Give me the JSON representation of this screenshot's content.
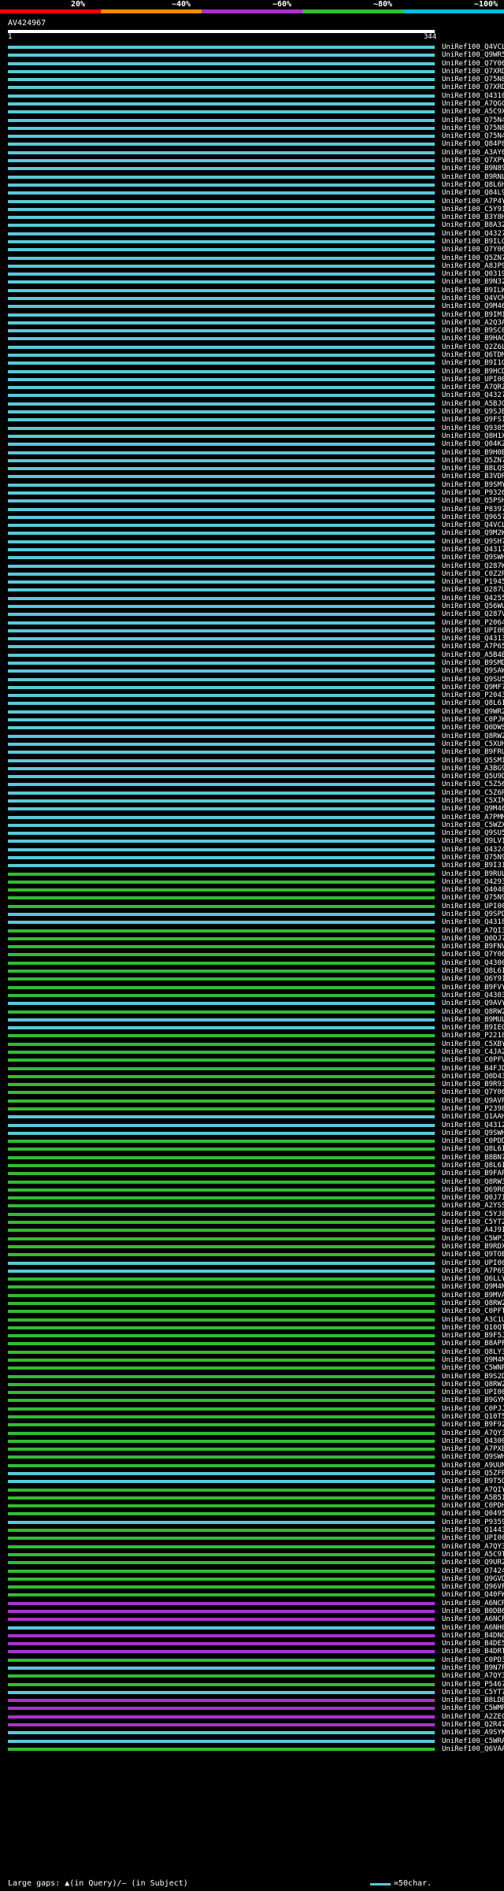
{
  "legend": {
    "labels": [
      "20%",
      "~40%",
      "~60%",
      "~80%",
      "~100%"
    ],
    "colors": [
      "#ff0000",
      "#ff8800",
      "#aa33cc",
      "#33bb33",
      "#00bfd7"
    ]
  },
  "query": {
    "name": "AV424967",
    "start": "1",
    "end": "344"
  },
  "hits": [
    {
      "label": "UniRef100_Q4VCL9",
      "color": "#59c9d9"
    },
    {
      "label": "UniRef100_Q9WR52",
      "color": "#59c9d9"
    },
    {
      "label": "UniRef100_Q7Y068",
      "color": "#59c9d9"
    },
    {
      "label": "UniRef100_Q7XRD3",
      "color": "#59c9d9"
    },
    {
      "label": "UniRef100_Q75N87",
      "color": "#59c9d9"
    },
    {
      "label": "UniRef100_Q7XRD1",
      "color": "#59c9d9"
    },
    {
      "label": "UniRef100_Q43106",
      "color": "#59c9d9"
    },
    {
      "label": "UniRef100_A7QGC0",
      "color": "#59c9d9"
    },
    {
      "label": "UniRef100_A5C9X8",
      "color": "#59c9d9"
    },
    {
      "label": "UniRef100_Q75N40",
      "color": "#59c9d9"
    },
    {
      "label": "UniRef100_Q75N88",
      "color": "#59c9d9"
    },
    {
      "label": "UniRef100_Q75N41",
      "color": "#59c9d9"
    },
    {
      "label": "UniRef100_Q84P88",
      "color": "#59c9d9"
    },
    {
      "label": "UniRef100_A3AY68",
      "color": "#59c9d9"
    },
    {
      "label": "UniRef100_Q7XPY2",
      "color": "#59c9d9"
    },
    {
      "label": "UniRef100_B9N895",
      "color": "#59c9d9"
    },
    {
      "label": "UniRef100_B9RNL5",
      "color": "#59c9d9"
    },
    {
      "label": "UniRef100_Q8L6H2",
      "color": "#59c9d9"
    },
    {
      "label": "UniRef100_Q84L97",
      "color": "#59c9d9"
    },
    {
      "label": "UniRef100_A7P4Y4",
      "color": "#59c9d9"
    },
    {
      "label": "UniRef100_C5Y910",
      "color": "#59c9d9"
    },
    {
      "label": "UniRef100_B3Y8H6",
      "color": "#59c9d9"
    },
    {
      "label": "UniRef100_B8A326",
      "color": "#59c9d9"
    },
    {
      "label": "UniRef100_Q43275",
      "color": "#59c9d9"
    },
    {
      "label": "UniRef100_B9ILG8",
      "color": "#59c9d9"
    },
    {
      "label": "UniRef100_Q7Y067",
      "color": "#59c9d9"
    },
    {
      "label": "UniRef100_Q5ZN71",
      "color": "#59c9d9"
    },
    {
      "label": "UniRef100_A8JP99",
      "color": "#59c9d9"
    },
    {
      "label": "UniRef100_Q03194",
      "color": "#59c9d9"
    },
    {
      "label": "UniRef100_B9N321",
      "color": "#59c9d9"
    },
    {
      "label": "UniRef100_B9ILW8",
      "color": "#59c9d9"
    },
    {
      "label": "UniRef100_Q4VCM0",
      "color": "#59c9d9"
    },
    {
      "label": "UniRef100_Q9M461",
      "color": "#59c9d9"
    },
    {
      "label": "UniRef100_B9IM11",
      "color": "#59c9d9"
    },
    {
      "label": "UniRef100_A2Q3A6",
      "color": "#59c9d9"
    },
    {
      "label": "UniRef100_B9SC05",
      "color": "#59c9d9"
    },
    {
      "label": "UniRef100_B9HAQ1",
      "color": "#59c9d9"
    },
    {
      "label": "UniRef100_Q2Z6L3",
      "color": "#59c9d9"
    },
    {
      "label": "UniRef100_Q6TDM4",
      "color": "#59c9d9"
    },
    {
      "label": "UniRef100_B9I1G7",
      "color": "#59c9d9"
    },
    {
      "label": "UniRef100_B9HCD3",
      "color": "#59c9d9"
    },
    {
      "label": "UniRef100_UPI000..",
      "color": "#59c9d9"
    },
    {
      "label": "UniRef100_A7QRZ8",
      "color": "#59c9d9"
    },
    {
      "label": "UniRef100_Q43271",
      "color": "#59c9d9"
    },
    {
      "label": "UniRef100_A5BJG2",
      "color": "#59c9d9"
    },
    {
      "label": "UniRef100_Q9SJB3",
      "color": "#59c9d9"
    },
    {
      "label": "UniRef100_Q9FS17",
      "color": "#59c9d9"
    },
    {
      "label": "UniRef100_Q93052",
      "color": "#59c9d9"
    },
    {
      "label": "UniRef100_Q8H1X2",
      "color": "#59c9d9"
    },
    {
      "label": "UniRef100_Q04KZ5",
      "color": "#59c9d9"
    },
    {
      "label": "UniRef100_B9H0B5",
      "color": "#59c9d9"
    },
    {
      "label": "UniRef100_Q5ZN70",
      "color": "#59c9d9"
    },
    {
      "label": "UniRef100_B8LQS1",
      "color": "#59c9d9"
    },
    {
      "label": "UniRef100_B3VDR8",
      "color": "#59c9d9"
    },
    {
      "label": "UniRef100_B9SMY3",
      "color": "#59c9d9"
    },
    {
      "label": "UniRef100_P93265",
      "color": "#59c9d9"
    },
    {
      "label": "UniRef100_Q5PSH6",
      "color": "#59c9d9"
    },
    {
      "label": "UniRef100_P83970",
      "color": "#59c9d9"
    },
    {
      "label": "UniRef100_Q96578",
      "color": "#59c9d9"
    },
    {
      "label": "UniRef100_Q4VCL8",
      "color": "#59c9d9"
    },
    {
      "label": "UniRef100_Q9M2W0",
      "color": "#59c9d9"
    },
    {
      "label": "UniRef100_Q9SH76",
      "color": "#59c9d9"
    },
    {
      "label": "UniRef100_Q43178",
      "color": "#59c9d9"
    },
    {
      "label": "UniRef100_Q9SWH2",
      "color": "#59c9d9"
    },
    {
      "label": "UniRef100_Q287W5",
      "color": "#59c9d9"
    },
    {
      "label": "UniRef100_C0Z2R2",
      "color": "#59c9d9"
    },
    {
      "label": "UniRef100_P19456",
      "color": "#59c9d9"
    },
    {
      "label": "UniRef100_Q287U6",
      "color": "#59c9d9"
    },
    {
      "label": "UniRef100_Q42556",
      "color": "#59c9d9"
    },
    {
      "label": "UniRef100_Q56WU9",
      "color": "#59c9d9"
    },
    {
      "label": "UniRef100_Q287V1",
      "color": "#59c9d9"
    },
    {
      "label": "UniRef100_P20649",
      "color": "#59c9d9"
    },
    {
      "label": "UniRef100_UPI000..",
      "color": "#59c9d9"
    },
    {
      "label": "UniRef100_Q43131",
      "color": "#59c9d9"
    },
    {
      "label": "UniRef100_A7P650",
      "color": "#59c9d9"
    },
    {
      "label": "UniRef100_A5B4B3",
      "color": "#59c9d9"
    },
    {
      "label": "UniRef100_B9SMD1",
      "color": "#59c9d9"
    },
    {
      "label": "UniRef100_Q9SAW3",
      "color": "#59c9d9"
    },
    {
      "label": "UniRef100_Q9SU58",
      "color": "#59c9d9"
    },
    {
      "label": "UniRef100_Q9MF7",
      "color": "#59c9d9"
    },
    {
      "label": "UniRef100_P20431",
      "color": "#59c9d9"
    },
    {
      "label": "UniRef100_Q8L6I0",
      "color": "#59c9d9"
    },
    {
      "label": "UniRef100_Q9WR25",
      "color": "#59c9d9"
    },
    {
      "label": "UniRef100_C0PJW4",
      "color": "#59c9d9"
    },
    {
      "label": "UniRef100_Q0DWS9",
      "color": "#59c9d9"
    },
    {
      "label": "UniRef100_Q8RW25",
      "color": "#59c9d9"
    },
    {
      "label": "UniRef100_C5XUH7",
      "color": "#59c9d9"
    },
    {
      "label": "UniRef100_B9FRU8",
      "color": "#59c9d9"
    },
    {
      "label": "UniRef100_Q5SM15",
      "color": "#59c9d9"
    },
    {
      "label": "UniRef100_A3BG91",
      "color": "#59c9d9"
    },
    {
      "label": "UniRef100_Q5U9D4",
      "color": "#59c9d9"
    },
    {
      "label": "UniRef100_C5Z567",
      "color": "#59c9d9"
    },
    {
      "label": "UniRef100_C5Z6R9",
      "color": "#59c9d9"
    },
    {
      "label": "UniRef100_C5XIN5",
      "color": "#59c9d9"
    },
    {
      "label": "UniRef100_Q9M469",
      "color": "#59c9d9"
    },
    {
      "label": "UniRef100_A7PMM1",
      "color": "#59c9d9"
    },
    {
      "label": "UniRef100_C5WZX7",
      "color": "#59c9d9"
    },
    {
      "label": "UniRef100_Q9SU56",
      "color": "#59c9d9"
    },
    {
      "label": "UniRef100_Q9LV11",
      "color": "#59c9d9"
    },
    {
      "label": "UniRef100_Q43243",
      "color": "#59c9d9"
    },
    {
      "label": "UniRef100_Q75N99",
      "color": "#59c9d9"
    },
    {
      "label": "UniRef100_B9I315",
      "color": "#59c9d9"
    },
    {
      "label": "UniRef100_B9RUL2",
      "color": "#33bb33"
    },
    {
      "label": "UniRef100_Q42932",
      "color": "#33bb33"
    },
    {
      "label": "UniRef100_Q40409",
      "color": "#33bb33"
    },
    {
      "label": "UniRef100_Q75N96",
      "color": "#33bb33"
    },
    {
      "label": "UniRef100_UPI000..",
      "color": "#33bb33"
    },
    {
      "label": "UniRef100_Q9SPD5",
      "color": "#59c9d9"
    },
    {
      "label": "UniRef100_Q43182",
      "color": "#59c9d9"
    },
    {
      "label": "UniRef100_A7QI32",
      "color": "#33bb33"
    },
    {
      "label": "UniRef100_Q0DJ73",
      "color": "#33bb33"
    },
    {
      "label": "UniRef100_B9FNV9",
      "color": "#33bb33"
    },
    {
      "label": "UniRef100_Q7Y065",
      "color": "#33bb33"
    },
    {
      "label": "UniRef100_Q43002",
      "color": "#33bb33"
    },
    {
      "label": "UniRef100_Q8L6I2",
      "color": "#33bb33"
    },
    {
      "label": "UniRef100_Q6Y914",
      "color": "#33bb33"
    },
    {
      "label": "UniRef100_B9FVY5",
      "color": "#33bb33"
    },
    {
      "label": "UniRef100_Q43035",
      "color": "#33bb33"
    },
    {
      "label": "UniRef100_Q9AVY3",
      "color": "#59c9d9"
    },
    {
      "label": "UniRef100_Q8RW29",
      "color": "#33bb33"
    },
    {
      "label": "UniRef100_B9MUL1",
      "color": "#59c9d9"
    },
    {
      "label": "UniRef100_B9IEG7",
      "color": "#59c9d9"
    },
    {
      "label": "UniRef100_P22180",
      "color": "#33bb33"
    },
    {
      "label": "UniRef100_C5XBY1",
      "color": "#33bb33"
    },
    {
      "label": "UniRef100_C4JA28",
      "color": "#33bb33"
    },
    {
      "label": "UniRef100_C0PFV1",
      "color": "#33bb33"
    },
    {
      "label": "UniRef100_B4FJD3",
      "color": "#33bb33"
    },
    {
      "label": "UniRef100_Q0D436",
      "color": "#33bb33"
    },
    {
      "label": "UniRef100_B9R933",
      "color": "#33bb33"
    },
    {
      "label": "UniRef100_Q7Y066",
      "color": "#33bb33"
    },
    {
      "label": "UniRef100_Q9AVP6",
      "color": "#33bb33"
    },
    {
      "label": "UniRef100_P23980",
      "color": "#33bb33"
    },
    {
      "label": "UniRef100_Q1AAH1",
      "color": "#59c9d9"
    },
    {
      "label": "UniRef100_Q43128",
      "color": "#59c9d9"
    },
    {
      "label": "UniRef100_Q9SWH0",
      "color": "#59c9d9"
    },
    {
      "label": "UniRef100_C0PDD5",
      "color": "#33bb33"
    },
    {
      "label": "UniRef100_Q8L6I1",
      "color": "#33bb33"
    },
    {
      "label": "UniRef100_B8BN76",
      "color": "#33bb33"
    },
    {
      "label": "UniRef100_Q8L6I3",
      "color": "#33bb33"
    },
    {
      "label": "UniRef100_B9FAP3",
      "color": "#33bb33"
    },
    {
      "label": "UniRef100_Q8RW30",
      "color": "#33bb33"
    },
    {
      "label": "UniRef100_Q69R65",
      "color": "#33bb33"
    },
    {
      "label": "UniRef100_Q0J713",
      "color": "#33bb33"
    },
    {
      "label": "UniRef100_A2YSS8",
      "color": "#33bb33"
    },
    {
      "label": "UniRef100_C5YJ05",
      "color": "#33bb33"
    },
    {
      "label": "UniRef100_C5YT23",
      "color": "#33bb33"
    },
    {
      "label": "UniRef100_A4J9I5",
      "color": "#33bb33"
    },
    {
      "label": "UniRef100_C5WPJ0",
      "color": "#33bb33"
    },
    {
      "label": "UniRef100_B9RDX9",
      "color": "#33bb33"
    },
    {
      "label": "UniRef100_Q9TOE0",
      "color": "#33bb33"
    },
    {
      "label": "UniRef100_UPI000..",
      "color": "#59c9d9"
    },
    {
      "label": "UniRef100_A7P695",
      "color": "#59c9d9"
    },
    {
      "label": "UniRef100_Q6LLY9",
      "color": "#33bb33"
    },
    {
      "label": "UniRef100_Q9M4N3",
      "color": "#33bb33"
    },
    {
      "label": "UniRef100_B9MVA1",
      "color": "#33bb33"
    },
    {
      "label": "UniRef100_Q8RW26",
      "color": "#33bb33"
    },
    {
      "label": "UniRef100_C0PFT0",
      "color": "#33bb33"
    },
    {
      "label": "UniRef100_A3C1U4",
      "color": "#33bb33"
    },
    {
      "label": "UniRef100_Q10QT6",
      "color": "#33bb33"
    },
    {
      "label": "UniRef100_B9F5J0",
      "color": "#33bb33"
    },
    {
      "label": "UniRef100_B8APF6",
      "color": "#33bb33"
    },
    {
      "label": "UniRef100_Q8LY32",
      "color": "#33bb33"
    },
    {
      "label": "UniRef100_Q9M4N4",
      "color": "#33bb33"
    },
    {
      "label": "UniRef100_C5WNP1",
      "color": "#33bb33"
    },
    {
      "label": "UniRef100_B9S2D4",
      "color": "#33bb33"
    },
    {
      "label": "UniRef100_Q8RW27",
      "color": "#33bb33"
    },
    {
      "label": "UniRef100_UPI000..",
      "color": "#33bb33"
    },
    {
      "label": "UniRef100_B9GYM5",
      "color": "#33bb33"
    },
    {
      "label": "UniRef100_C0PJJ7",
      "color": "#33bb33"
    },
    {
      "label": "UniRef100_Q10T57",
      "color": "#33bb33"
    },
    {
      "label": "UniRef100_B9F928",
      "color": "#33bb33"
    },
    {
      "label": "UniRef100_A7QY39",
      "color": "#33bb33"
    },
    {
      "label": "UniRef100_Q43001",
      "color": "#33bb33"
    },
    {
      "label": "UniRef100_A7PXB7",
      "color": "#33bb33"
    },
    {
      "label": "UniRef100_Q9SWH1",
      "color": "#33bb33"
    },
    {
      "label": "UniRef100_A9UUN9",
      "color": "#33bb33"
    },
    {
      "label": "UniRef100_Q5ZFR6",
      "color": "#59c9d9"
    },
    {
      "label": "UniRef100_B9T5Q1",
      "color": "#59c9d9"
    },
    {
      "label": "UniRef100_A7QIY5",
      "color": "#33bb33"
    },
    {
      "label": "UniRef100_A5B516",
      "color": "#33bb33"
    },
    {
      "label": "UniRef100_C0PDH2",
      "color": "#33bb33"
    },
    {
      "label": "UniRef100_Q04956",
      "color": "#33bb33"
    },
    {
      "label": "UniRef100_P93597",
      "color": "#59c9d9"
    },
    {
      "label": "UniRef100_Q14437",
      "color": "#33bb33"
    },
    {
      "label": "UniRef100_UPI000..",
      "color": "#33bb33"
    },
    {
      "label": "UniRef100_A7QY32",
      "color": "#33bb33"
    },
    {
      "label": "UniRef100_A5C9T1",
      "color": "#33bb33"
    },
    {
      "label": "UniRef100_Q9UR20",
      "color": "#33bb33"
    },
    {
      "label": "UniRef100_O74242",
      "color": "#33bb33"
    },
    {
      "label": "UniRef100_Q9GVD3",
      "color": "#33bb33"
    },
    {
      "label": "UniRef100_Q96VF1",
      "color": "#33bb33"
    },
    {
      "label": "UniRef100_Q40FW6",
      "color": "#33bb33"
    },
    {
      "label": "UniRef100_A6NCR3",
      "color": "#aa33cc"
    },
    {
      "label": "UniRef100_B0DB65",
      "color": "#aa33cc"
    },
    {
      "label": "UniRef100_A6NCF5",
      "color": "#aa33cc"
    },
    {
      "label": "UniRef100_A6NH06",
      "color": "#59c9d9"
    },
    {
      "label": "UniRef100_B4DNG8",
      "color": "#aa33cc"
    },
    {
      "label": "UniRef100_B4DE52",
      "color": "#aa33cc"
    },
    {
      "label": "UniRef100_B4DRT6",
      "color": "#aa33cc"
    },
    {
      "label": "UniRef100_C0PD32",
      "color": "#33bb33"
    },
    {
      "label": "UniRef100_B9N7P7",
      "color": "#59c9d9"
    },
    {
      "label": "UniRef100_A7QY37",
      "color": "#33bb33"
    },
    {
      "label": "UniRef100_P54679",
      "color": "#33bb33"
    },
    {
      "label": "UniRef100_C5YT75",
      "color": "#59c9d9"
    },
    {
      "label": "UniRef100_B8LDB0",
      "color": "#aa33cc"
    },
    {
      "label": "UniRef100_C5WMR8",
      "color": "#aa33cc"
    },
    {
      "label": "UniRef100_A2ZEC9",
      "color": "#aa33cc"
    },
    {
      "label": "UniRef100_Q2R471",
      "color": "#aa33cc"
    },
    {
      "label": "UniRef100_A9SYK6",
      "color": "#59c9d9"
    },
    {
      "label": "UniRef100_C5WRA6",
      "color": "#59c9d9"
    },
    {
      "label": "UniRef100_Q6VAA7",
      "color": "#33bb33"
    }
  ],
  "footer": {
    "gaps_text": "Large gaps: ▲(in Query)/– (in Subject)",
    "scale_text": "=50char."
  }
}
